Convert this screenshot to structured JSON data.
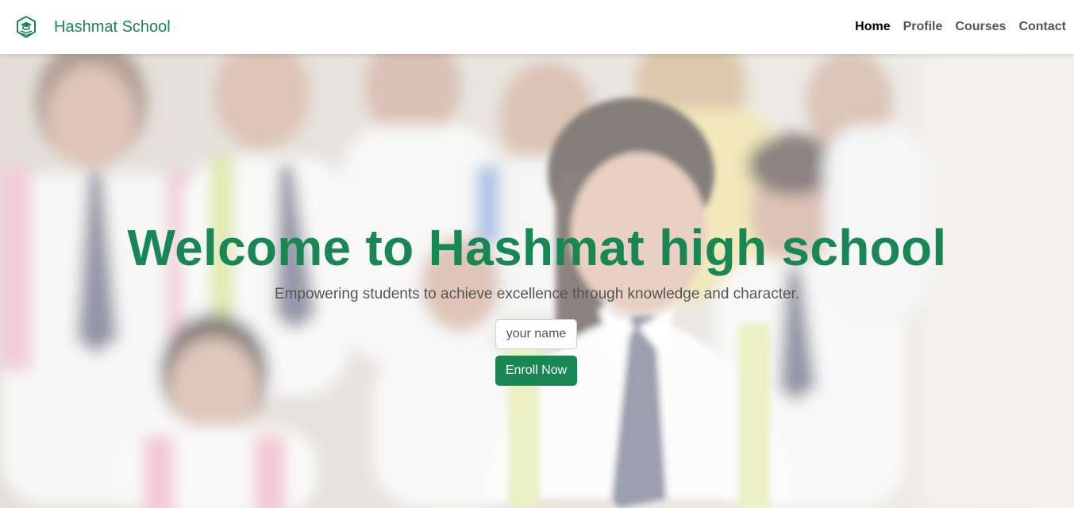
{
  "brand": {
    "name": "Hashmat School",
    "logo_icon": "graduation-cap-book-icon",
    "color": "#198754"
  },
  "nav": {
    "items": [
      {
        "label": "Home",
        "active": true
      },
      {
        "label": "Profile",
        "active": false
      },
      {
        "label": "Courses",
        "active": false
      },
      {
        "label": "Contact",
        "active": false
      }
    ]
  },
  "hero": {
    "title": "Welcome to Hashmat high school",
    "subtitle": "Empowering students to achieve excellence through knowledge and character.",
    "name_input": {
      "value": "",
      "placeholder": "your name"
    },
    "enroll_label": "Enroll Now",
    "background": "faded photo of school students in white uniforms"
  },
  "colors": {
    "accent": "#198754",
    "nav_text": "#555555",
    "nav_active": "#000000"
  }
}
